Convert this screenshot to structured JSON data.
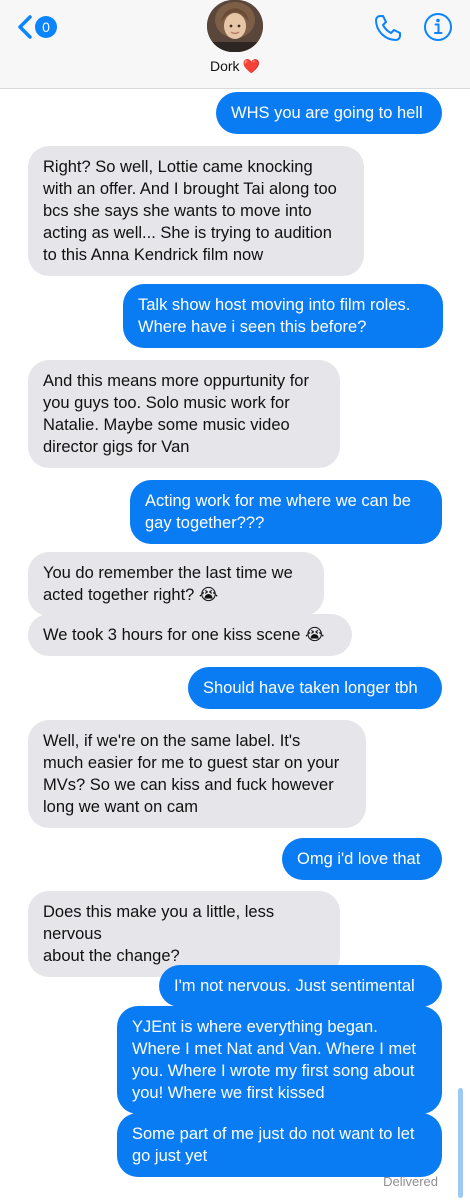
{
  "header": {
    "back_badge": "0",
    "contact_name": "Dork",
    "contact_emoji": "❤️"
  },
  "messages": [
    {
      "from": "me",
      "text": "WHS you are going to hell"
    },
    {
      "from": "them",
      "text": "Right? So well, Lottie came knocking\nwith an offer. And I brought Tai along too\nbcs she says she wants to move into\nacting as well... She is trying to audition\nto this Anna Kendrick film now"
    },
    {
      "from": "me",
      "text": "Talk show host moving into film roles.\nWhere have i seen this before?"
    },
    {
      "from": "them",
      "text": "And this means more oppurtunity for\nyou guys too. Solo music work for\nNatalie. Maybe some music video\ndirector gigs for Van"
    },
    {
      "from": "me",
      "text": "Acting work for me where we can be\ngay together???"
    },
    {
      "from": "them",
      "text": "You do remember the last time we\nacted together right? 😭"
    },
    {
      "from": "them",
      "text": "We took 3 hours for one kiss scene 😭"
    },
    {
      "from": "me",
      "text": "Should have taken longer tbh"
    },
    {
      "from": "them",
      "text": "Well, if we're on the same label. It's\nmuch easier for me to guest star on your\nMVs? So we can kiss and fuck however\nlong we want on cam"
    },
    {
      "from": "me",
      "text": "Omg i'd love that"
    },
    {
      "from": "them",
      "text": "Does this make you a little, less nervous\nabout the change?"
    },
    {
      "from": "me",
      "text": "I'm not nervous. Just sentimental"
    },
    {
      "from": "me",
      "text": "YJEnt is where everything began.\nWhere I met Nat and Van. Where I met\nyou. Where I wrote my first song about\nyou! Where we first kissed"
    },
    {
      "from": "me",
      "text": "Some part of me just do not want to let\ngo just yet"
    }
  ],
  "status": "Delivered",
  "colors": {
    "outgoing": "#0a7cf3",
    "incoming": "#e5e5ea",
    "accent": "#0a84ff"
  }
}
